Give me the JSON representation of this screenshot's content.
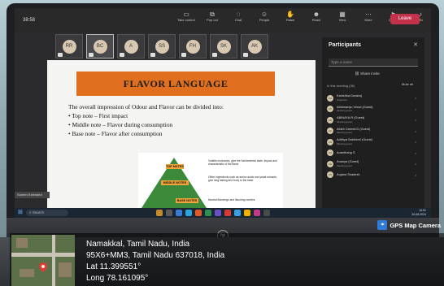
{
  "meeting": {
    "timer": "38:58",
    "toolbar": [
      {
        "icon": "take-control-icon",
        "label": "Take control"
      },
      {
        "icon": "pop-out-icon",
        "label": "Pop out"
      },
      {
        "icon": "chat-icon",
        "label": "Chat"
      },
      {
        "icon": "people-icon",
        "label": "People",
        "badge": "33"
      },
      {
        "icon": "raise-hand-icon",
        "label": "Raise"
      },
      {
        "icon": "react-icon",
        "label": "React"
      },
      {
        "icon": "view-icon",
        "label": "View"
      },
      {
        "icon": "more-icon",
        "label": "More"
      },
      {
        "icon": "camera-icon",
        "label": "Camera"
      },
      {
        "icon": "mic-icon",
        "label": "Mic"
      },
      {
        "icon": "share-icon",
        "label": "Share"
      }
    ],
    "leave_label": "Leave",
    "avatars": [
      "RR",
      "BC",
      "A",
      "SS",
      "FH",
      "SK",
      "AK"
    ],
    "recording_label": "Screen Extended"
  },
  "slide": {
    "title": "FLAVOR LANGUAGE",
    "intro": "The overall impression of Odour and Flavor can be divided into:",
    "bullets": [
      "Top note – First impact",
      "Middle note – Flavor during consumption",
      "Base note – Flavor after consumption"
    ],
    "pyramid": [
      {
        "level": "TOP NOTES",
        "text": "Volatile molecules, give the fundamental taste, impact and characteristic of the flavor"
      },
      {
        "level": "MIDDLE NOTES",
        "text": "Other ingredients such as amino acids and yeast extracts, give long lasting and body to the taste"
      },
      {
        "level": "BASE NOTES",
        "text": "Neutral flavorings and flavoring carriers"
      }
    ]
  },
  "participants": {
    "title": "Participants",
    "search_placeholder": "Type a name",
    "share_invite": "Share invite",
    "in_meeting": "In this meeting (39)",
    "mute_all": "Mute all",
    "list": [
      {
        "initials": "KD",
        "name": "Kanishka Durairaj",
        "role": "Organizer"
      },
      {
        "initials": "AV",
        "name": "Abhimanyu Vinod (Guest)",
        "role": "Meeting guest"
      },
      {
        "initials": "AR",
        "name": "ABINAYA.R (Guest)",
        "role": "Meeting guest"
      },
      {
        "initials": "AC",
        "name": "Abish Carmel.D (Guest)",
        "role": "Meeting guest"
      },
      {
        "initials": "AS",
        "name": "Adithya Sakthivel (Guest)",
        "role": "Meeting guest"
      },
      {
        "initials": "AS",
        "name": "Ananthang S",
        "role": ""
      },
      {
        "initials": "AG",
        "name": "Ananya (Guest)",
        "role": "Meeting guest"
      },
      {
        "initials": "AS",
        "name": "Anjaha Shadesh",
        "role": ""
      }
    ]
  },
  "taskbar": {
    "search_label": "Search",
    "time": "10:51",
    "date": "30-08-2024",
    "app_colors": [
      "#c48a2a",
      "#5a5a5a",
      "#3a7bd5",
      "#2aa3d8",
      "#e05a2a",
      "#2e8f52",
      "#6a4fc4",
      "#d83a3a",
      "#3aa0e0",
      "#f0b400",
      "#c43a8a",
      "#4a4a4a"
    ]
  },
  "laptop": {
    "logo": "hp"
  },
  "gps": {
    "brand": "GPS Map Camera",
    "location": "Namakkal, Tamil Nadu, India",
    "address": "95X6+MM3, Tamil Nadu 637018, India",
    "lat": "Lat 11.399551°",
    "long": "Long 78.161095°"
  }
}
